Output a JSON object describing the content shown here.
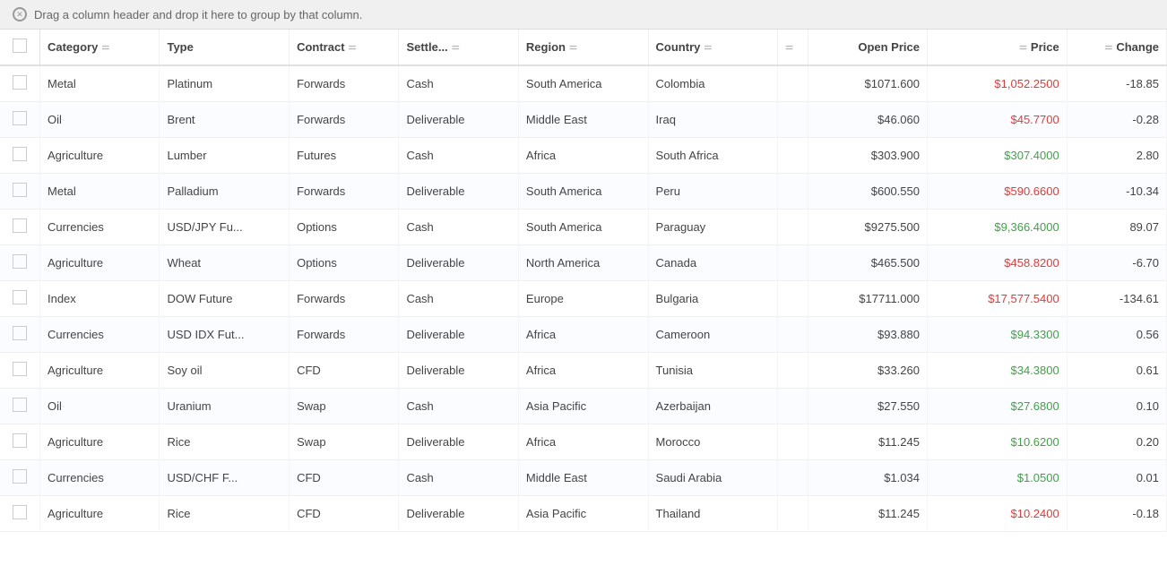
{
  "dragBar": {
    "label": "Drag a column header and drop it here to group by that column."
  },
  "columns": [
    {
      "id": "checkbox",
      "label": ""
    },
    {
      "id": "category",
      "label": "Category"
    },
    {
      "id": "type",
      "label": "Type"
    },
    {
      "id": "contract",
      "label": "Contract"
    },
    {
      "id": "settle",
      "label": "Settle..."
    },
    {
      "id": "region",
      "label": "Region"
    },
    {
      "id": "country",
      "label": "Country"
    },
    {
      "id": "empty",
      "label": ""
    },
    {
      "id": "openprice",
      "label": "Open Price"
    },
    {
      "id": "price",
      "label": "Price"
    },
    {
      "id": "change",
      "label": "Change"
    }
  ],
  "rows": [
    {
      "category": "Metal",
      "type": "Platinum",
      "contract": "Forwards",
      "settle": "Cash",
      "region": "South America",
      "country": "Colombia",
      "openPrice": "$1071.600",
      "price": "$1,052.2500",
      "priceColor": "red",
      "change": "-18.85"
    },
    {
      "category": "Oil",
      "type": "Brent",
      "contract": "Forwards",
      "settle": "Deliverable",
      "region": "Middle East",
      "country": "Iraq",
      "openPrice": "$46.060",
      "price": "$45.7700",
      "priceColor": "red",
      "change": "-0.28"
    },
    {
      "category": "Agriculture",
      "type": "Lumber",
      "contract": "Futures",
      "settle": "Cash",
      "region": "Africa",
      "country": "South Africa",
      "openPrice": "$303.900",
      "price": "$307.4000",
      "priceColor": "green",
      "change": "2.80"
    },
    {
      "category": "Metal",
      "type": "Palladium",
      "contract": "Forwards",
      "settle": "Deliverable",
      "region": "South America",
      "country": "Peru",
      "openPrice": "$600.550",
      "price": "$590.6600",
      "priceColor": "red",
      "change": "-10.34"
    },
    {
      "category": "Currencies",
      "type": "USD/JPY Fu...",
      "contract": "Options",
      "settle": "Cash",
      "region": "South America",
      "country": "Paraguay",
      "openPrice": "$9275.500",
      "price": "$9,366.4000",
      "priceColor": "green",
      "change": "89.07"
    },
    {
      "category": "Agriculture",
      "type": "Wheat",
      "contract": "Options",
      "settle": "Deliverable",
      "region": "North America",
      "country": "Canada",
      "openPrice": "$465.500",
      "price": "$458.8200",
      "priceColor": "red",
      "change": "-6.70"
    },
    {
      "category": "Index",
      "type": "DOW Future",
      "contract": "Forwards",
      "settle": "Cash",
      "region": "Europe",
      "country": "Bulgaria",
      "openPrice": "$17711.000",
      "price": "$17,577.5400",
      "priceColor": "red",
      "change": "-134.61"
    },
    {
      "category": "Currencies",
      "type": "USD IDX Fut...",
      "contract": "Forwards",
      "settle": "Deliverable",
      "region": "Africa",
      "country": "Cameroon",
      "openPrice": "$93.880",
      "price": "$94.3300",
      "priceColor": "green",
      "change": "0.56"
    },
    {
      "category": "Agriculture",
      "type": "Soy oil",
      "contract": "CFD",
      "settle": "Deliverable",
      "region": "Africa",
      "country": "Tunisia",
      "openPrice": "$33.260",
      "price": "$34.3800",
      "priceColor": "green",
      "change": "0.61"
    },
    {
      "category": "Oil",
      "type": "Uranium",
      "contract": "Swap",
      "settle": "Cash",
      "region": "Asia Pacific",
      "country": "Azerbaijan",
      "openPrice": "$27.550",
      "price": "$27.6800",
      "priceColor": "green",
      "change": "0.10"
    },
    {
      "category": "Agriculture",
      "type": "Rice",
      "contract": "Swap",
      "settle": "Deliverable",
      "region": "Africa",
      "country": "Morocco",
      "openPrice": "$11.245",
      "price": "$10.6200",
      "priceColor": "green",
      "change": "0.20"
    },
    {
      "category": "Currencies",
      "type": "USD/CHF F...",
      "contract": "CFD",
      "settle": "Cash",
      "region": "Middle East",
      "country": "Saudi Arabia",
      "openPrice": "$1.034",
      "price": "$1.0500",
      "priceColor": "green",
      "change": "0.01"
    },
    {
      "category": "Agriculture",
      "type": "Rice",
      "contract": "CFD",
      "settle": "Deliverable",
      "region": "Asia Pacific",
      "country": "Thailand",
      "openPrice": "$11.245",
      "price": "$10.2400",
      "priceColor": "red",
      "change": "-0.18"
    }
  ]
}
